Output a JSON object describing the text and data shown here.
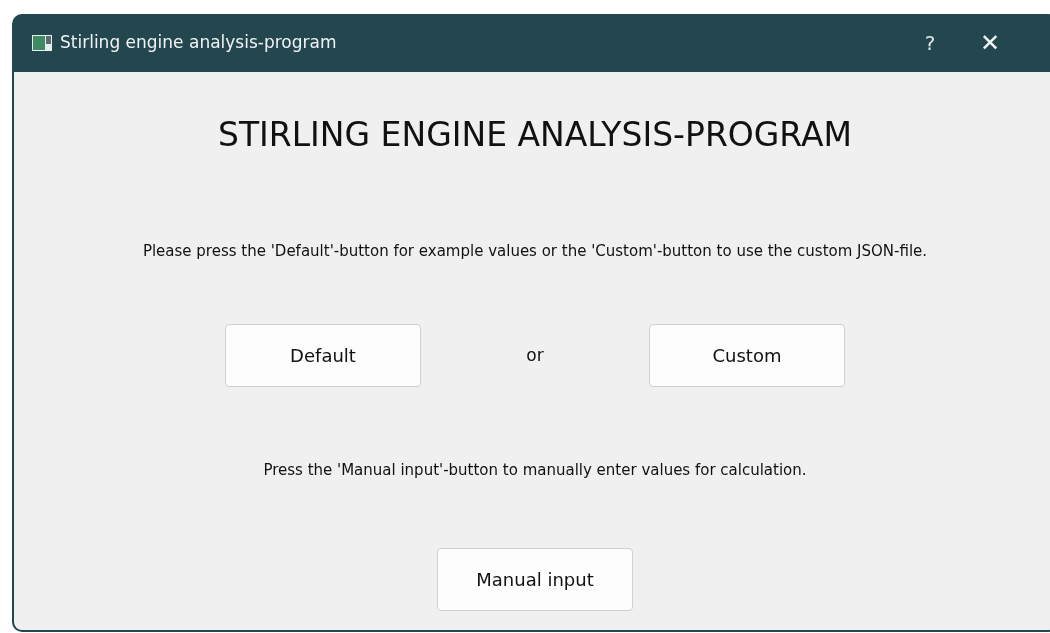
{
  "window": {
    "title": "Stirling engine analysis-program",
    "controls": [
      "?",
      "✕"
    ]
  },
  "heading": "STIRLING ENGINE ANALYSIS-PROGRAM",
  "instruction": "Please press the 'Default'-button for example values or the 'Custom'-button to use the custom JSON-file.",
  "choice_buttons": [
    "Default",
    "Custom"
  ],
  "separator": "or",
  "manual_instruction": "Press the 'Manual input'-button to manually enter values for calculation.",
  "manual_button": "Manual input"
}
